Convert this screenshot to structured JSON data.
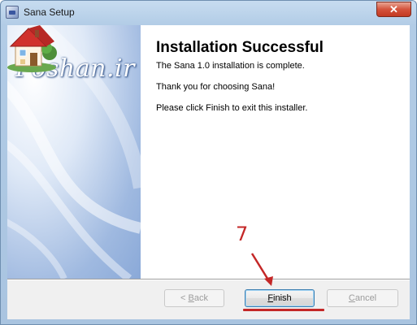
{
  "window": {
    "title": "Sana Setup",
    "close_glyph": "✕"
  },
  "banner": {
    "logo_text": "Poshan.ir",
    "illustration": "house-icon"
  },
  "content": {
    "heading": "Installation Successful",
    "line1": "The Sana 1.0 installation is complete.",
    "line2": "Thank you for choosing Sana!",
    "line3": "Please click Finish to exit this installer."
  },
  "buttons": {
    "back_prefix": "< ",
    "back_hotkey": "B",
    "back_rest": "ack",
    "finish_hotkey": "F",
    "finish_rest": "inish",
    "cancel_hotkey": "C",
    "cancel_rest": "ancel"
  },
  "annotation": {
    "step_number": "7",
    "color": "#c42727"
  }
}
